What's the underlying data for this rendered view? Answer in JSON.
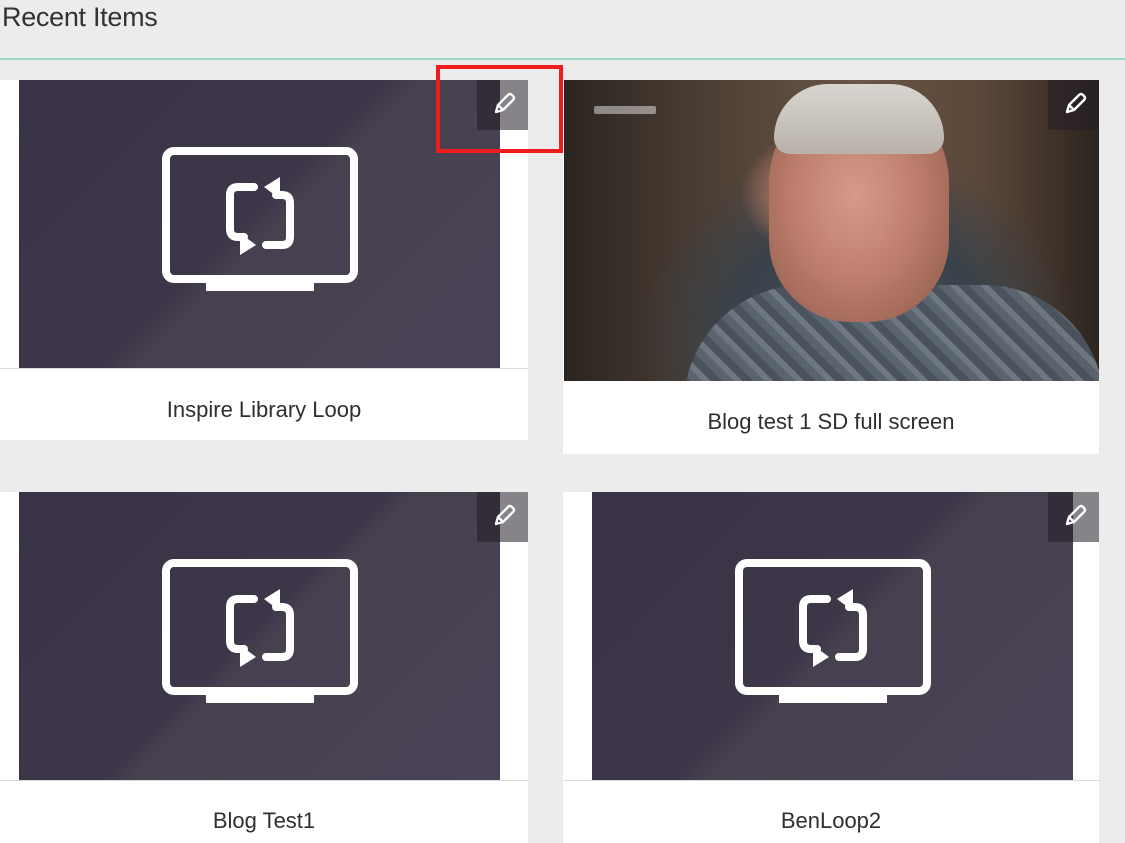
{
  "header": {
    "title": "Recent Items"
  },
  "items": [
    {
      "title": "Inspire Library Loop",
      "thumbnail": "loop-icon",
      "edit_icon": "pencil-icon"
    },
    {
      "title": "Blog test 1 SD full screen",
      "thumbnail": "video-still",
      "edit_icon": "pencil-icon"
    },
    {
      "title": "Blog Test1",
      "thumbnail": "loop-icon",
      "edit_icon": "pencil-icon"
    },
    {
      "title": "BenLoop2",
      "thumbnail": "loop-icon",
      "edit_icon": "pencil-icon"
    }
  ],
  "colors": {
    "thumbnail_bg": "#3d3649",
    "highlight": "#ee1c1c",
    "header_rule": "#9ad6c2"
  }
}
